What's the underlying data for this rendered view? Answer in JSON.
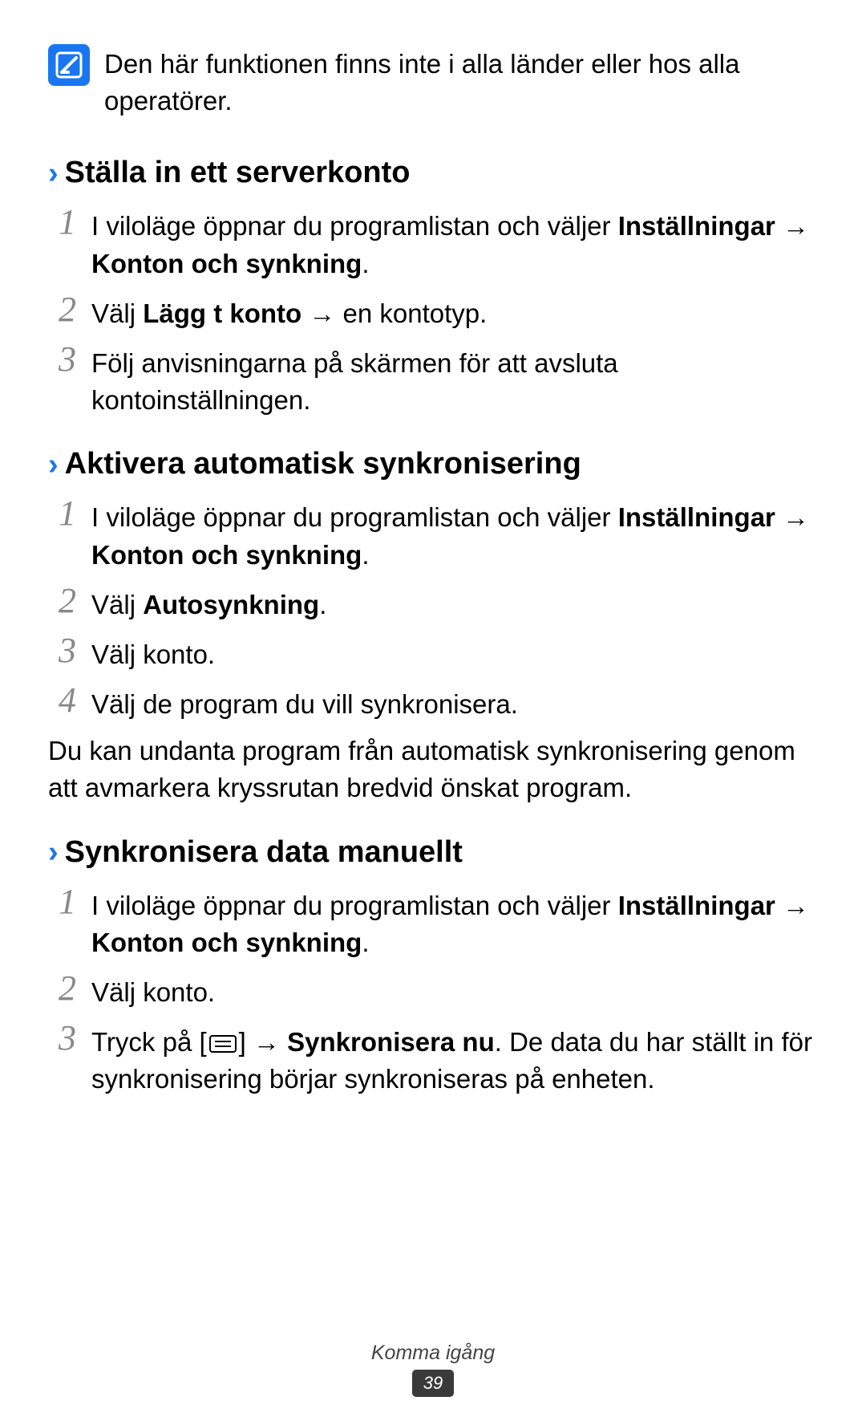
{
  "note": {
    "text": "Den här funktionen finns inte i alla länder eller hos alla operatörer."
  },
  "sections": [
    {
      "title": "Ställa in ett serverkonto",
      "steps": [
        {
          "num": "1",
          "parts": [
            {
              "text": "I viloläge öppnar du programlistan och väljer ",
              "bold": false
            },
            {
              "text": "Inställningar",
              "bold": true
            },
            {
              "text": " → ",
              "bold": false
            },
            {
              "text": "Konton och synkning",
              "bold": true
            },
            {
              "text": ".",
              "bold": false
            }
          ]
        },
        {
          "num": "2",
          "parts": [
            {
              "text": "Välj ",
              "bold": false
            },
            {
              "text": "Lägg t konto",
              "bold": true
            },
            {
              "text": " → en kontotyp.",
              "bold": false
            }
          ]
        },
        {
          "num": "3",
          "parts": [
            {
              "text": "Följ anvisningarna på skärmen för att avsluta kontoinställningen.",
              "bold": false
            }
          ]
        }
      ]
    },
    {
      "title": "Aktivera automatisk synkronisering",
      "steps": [
        {
          "num": "1",
          "parts": [
            {
              "text": "I viloläge öppnar du programlistan och väljer ",
              "bold": false
            },
            {
              "text": "Inställningar",
              "bold": true
            },
            {
              "text": " → ",
              "bold": false
            },
            {
              "text": "Konton och synkning",
              "bold": true
            },
            {
              "text": ".",
              "bold": false
            }
          ]
        },
        {
          "num": "2",
          "parts": [
            {
              "text": "Välj ",
              "bold": false
            },
            {
              "text": "Autosynkning",
              "bold": true
            },
            {
              "text": ".",
              "bold": false
            }
          ]
        },
        {
          "num": "3",
          "parts": [
            {
              "text": "Välj konto.",
              "bold": false
            }
          ]
        },
        {
          "num": "4",
          "parts": [
            {
              "text": "Välj de program du vill synkronisera.",
              "bold": false
            }
          ]
        }
      ],
      "after": "Du kan undanta program från automatisk synkronisering genom att avmarkera kryssrutan bredvid önskat program."
    },
    {
      "title": "Synkronisera data manuellt",
      "steps": [
        {
          "num": "1",
          "parts": [
            {
              "text": "I viloläge öppnar du programlistan och väljer ",
              "bold": false
            },
            {
              "text": "Inställningar",
              "bold": true
            },
            {
              "text": " → ",
              "bold": false
            },
            {
              "text": "Konton och synkning",
              "bold": true
            },
            {
              "text": ".",
              "bold": false
            }
          ]
        },
        {
          "num": "2",
          "parts": [
            {
              "text": "Välj konto.",
              "bold": false
            }
          ]
        },
        {
          "num": "3",
          "parts": [
            {
              "text": "Tryck på [",
              "bold": false
            },
            {
              "text": "MENU_ICON",
              "bold": false,
              "icon": true
            },
            {
              "text": "] → ",
              "bold": false
            },
            {
              "text": "Synkronisera nu",
              "bold": true
            },
            {
              "text": ". De data du har ställt in för synkronisering börjar synkroniseras på enheten.",
              "bold": false
            }
          ]
        }
      ]
    }
  ],
  "footer": {
    "section": "Komma igång",
    "page": "39"
  }
}
